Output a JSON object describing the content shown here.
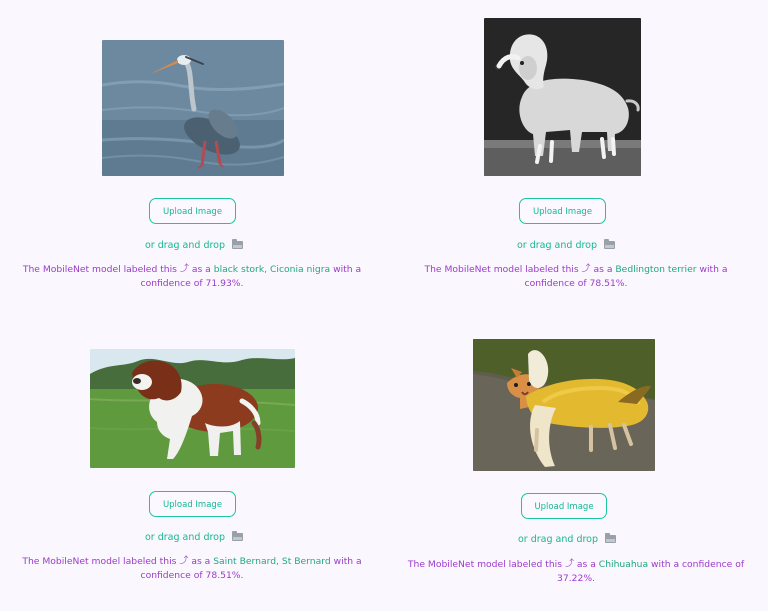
{
  "cards": [
    {
      "upload_label": "Upload Image",
      "drag_text": "or drag and drop",
      "caption_prefix": "The MobileNet model labeled this",
      "caption_mid": "as a",
      "result_label": "black stork, Ciconia nigra",
      "caption_after": "with a",
      "caption_second_line": "confidence of 71.93%.",
      "image_icon": "bird-photo"
    },
    {
      "upload_label": "Upload Image",
      "drag_text": "or drag and drop",
      "caption_prefix": "The MobileNet model labeled this",
      "caption_mid": "as a",
      "result_label": "Bedlington terrier",
      "caption_after": "with a",
      "caption_second_line": "confidence of 78.51%.",
      "image_icon": "terrier-photo"
    },
    {
      "upload_label": "Upload Image",
      "drag_text": "or drag and drop",
      "caption_prefix": "The MobileNet model labeled this",
      "caption_mid": "as a",
      "result_label": "Saint Bernard, St Bernard",
      "caption_after": "with a",
      "caption_second_line": "confidence of 78.51%.",
      "image_icon": "saint-bernard-photo"
    },
    {
      "upload_label": "Upload Image",
      "drag_text": "or drag and drop",
      "caption_prefix": "The MobileNet model labeled this",
      "caption_mid": "as a",
      "result_label": "Chihuahua",
      "caption_after": "with a confidence of",
      "caption_second_line": "37.22%.",
      "image_icon": "banana-dog-photo"
    }
  ],
  "ui": {
    "accent_color": "#18c7a1",
    "caption_color": "#9b3bc9",
    "background_color": "#fbf7ff",
    "folder_icon": "folder-icon",
    "arrow_icon": "upward-arrow-icon"
  }
}
